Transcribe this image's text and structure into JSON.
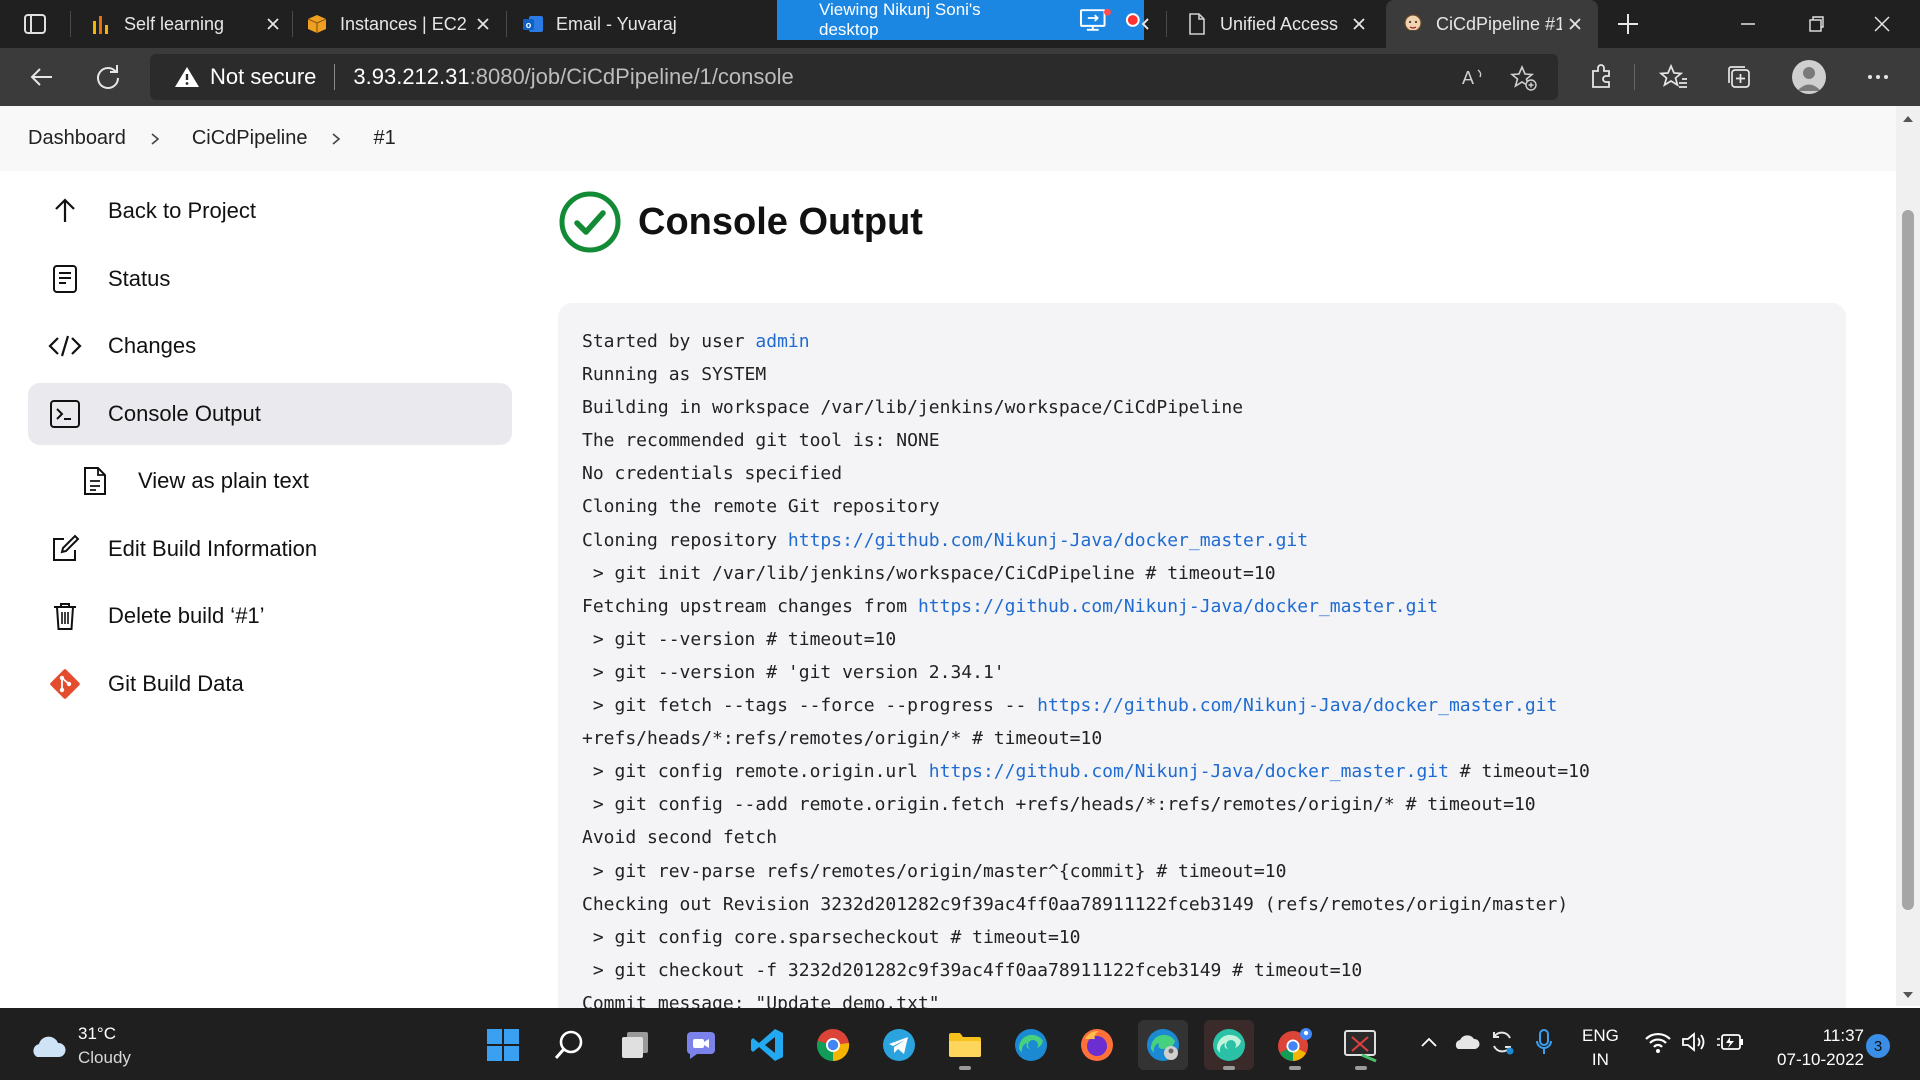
{
  "browser": {
    "tabs": [
      {
        "title": "Self learning"
      },
      {
        "title": "Instances | EC2"
      },
      {
        "title": "Email - Yuvaraj"
      },
      {
        "title": "Unified Access"
      },
      {
        "title": "CiCdPipeline #1"
      }
    ],
    "screenshare_label": "Viewing Nikunj Soni's desktop",
    "security_label": "Not secure",
    "url_host": "3.93.212.31",
    "url_path": ":8080/job/CiCdPipeline/1/console"
  },
  "breadcrumb": [
    "Dashboard",
    "CiCdPipeline",
    "#1"
  ],
  "sidebar": {
    "items": [
      {
        "label": "Back to Project",
        "icon": "arrow-up-icon"
      },
      {
        "label": "Status",
        "icon": "document-icon"
      },
      {
        "label": "Changes",
        "icon": "code-icon"
      },
      {
        "label": "Console Output",
        "icon": "terminal-icon",
        "active": true
      },
      {
        "label": "View as plain text",
        "icon": "file-text-icon"
      },
      {
        "label": "Edit Build Information",
        "icon": "edit-icon"
      },
      {
        "label": "Delete build ‘#1’",
        "icon": "trash-icon"
      },
      {
        "label": "Git Build Data",
        "icon": "git-icon"
      }
    ]
  },
  "main": {
    "title": "Console Output",
    "status": "success",
    "console_lines": [
      [
        "Started by user ",
        {
          "link": "admin"
        }
      ],
      [
        "Running as SYSTEM"
      ],
      [
        "Building in workspace /var/lib/jenkins/workspace/CiCdPipeline"
      ],
      [
        "The recommended git tool is: NONE"
      ],
      [
        "No credentials specified"
      ],
      [
        "Cloning the remote Git repository"
      ],
      [
        "Cloning repository ",
        {
          "link": "https://github.com/Nikunj-Java/docker_master.git"
        }
      ],
      [
        " > git init /var/lib/jenkins/workspace/CiCdPipeline # timeout=10"
      ],
      [
        "Fetching upstream changes from ",
        {
          "link": "https://github.com/Nikunj-Java/docker_master.git"
        }
      ],
      [
        " > git --version # timeout=10"
      ],
      [
        " > git --version # 'git version 2.34.1'"
      ],
      [
        " > git fetch --tags --force --progress -- ",
        {
          "link": "https://github.com/Nikunj-Java/docker_master.git"
        }
      ],
      [
        "+refs/heads/*:refs/remotes/origin/* # timeout=10"
      ],
      [
        " > git config remote.origin.url ",
        {
          "link": "https://github.com/Nikunj-Java/docker_master.git"
        },
        " # timeout=10"
      ],
      [
        " > git config --add remote.origin.fetch +refs/heads/*:refs/remotes/origin/* # timeout=10"
      ],
      [
        "Avoid second fetch"
      ],
      [
        " > git rev-parse refs/remotes/origin/master^{commit} # timeout=10"
      ],
      [
        "Checking out Revision 3232d201282c9f39ac4ff0aa78911122fceb3149 (refs/remotes/origin/master)"
      ],
      [
        " > git config core.sparsecheckout # timeout=10"
      ],
      [
        " > git checkout -f 3232d201282c9f39ac4ff0aa78911122fceb3149 # timeout=10"
      ],
      [
        "Commit message: \"Update demo.txt\""
      ]
    ]
  },
  "taskbar": {
    "weather_temp": "31°C",
    "weather_desc": "Cloudy",
    "lang_line1": "ENG",
    "lang_line2": "IN",
    "time": "11:37",
    "date": "07-10-2022",
    "notification_count": "3"
  },
  "colors": {
    "link": "#1f6bd1",
    "success": "#138a36",
    "taskbar_bg": "#1f1f1f"
  }
}
